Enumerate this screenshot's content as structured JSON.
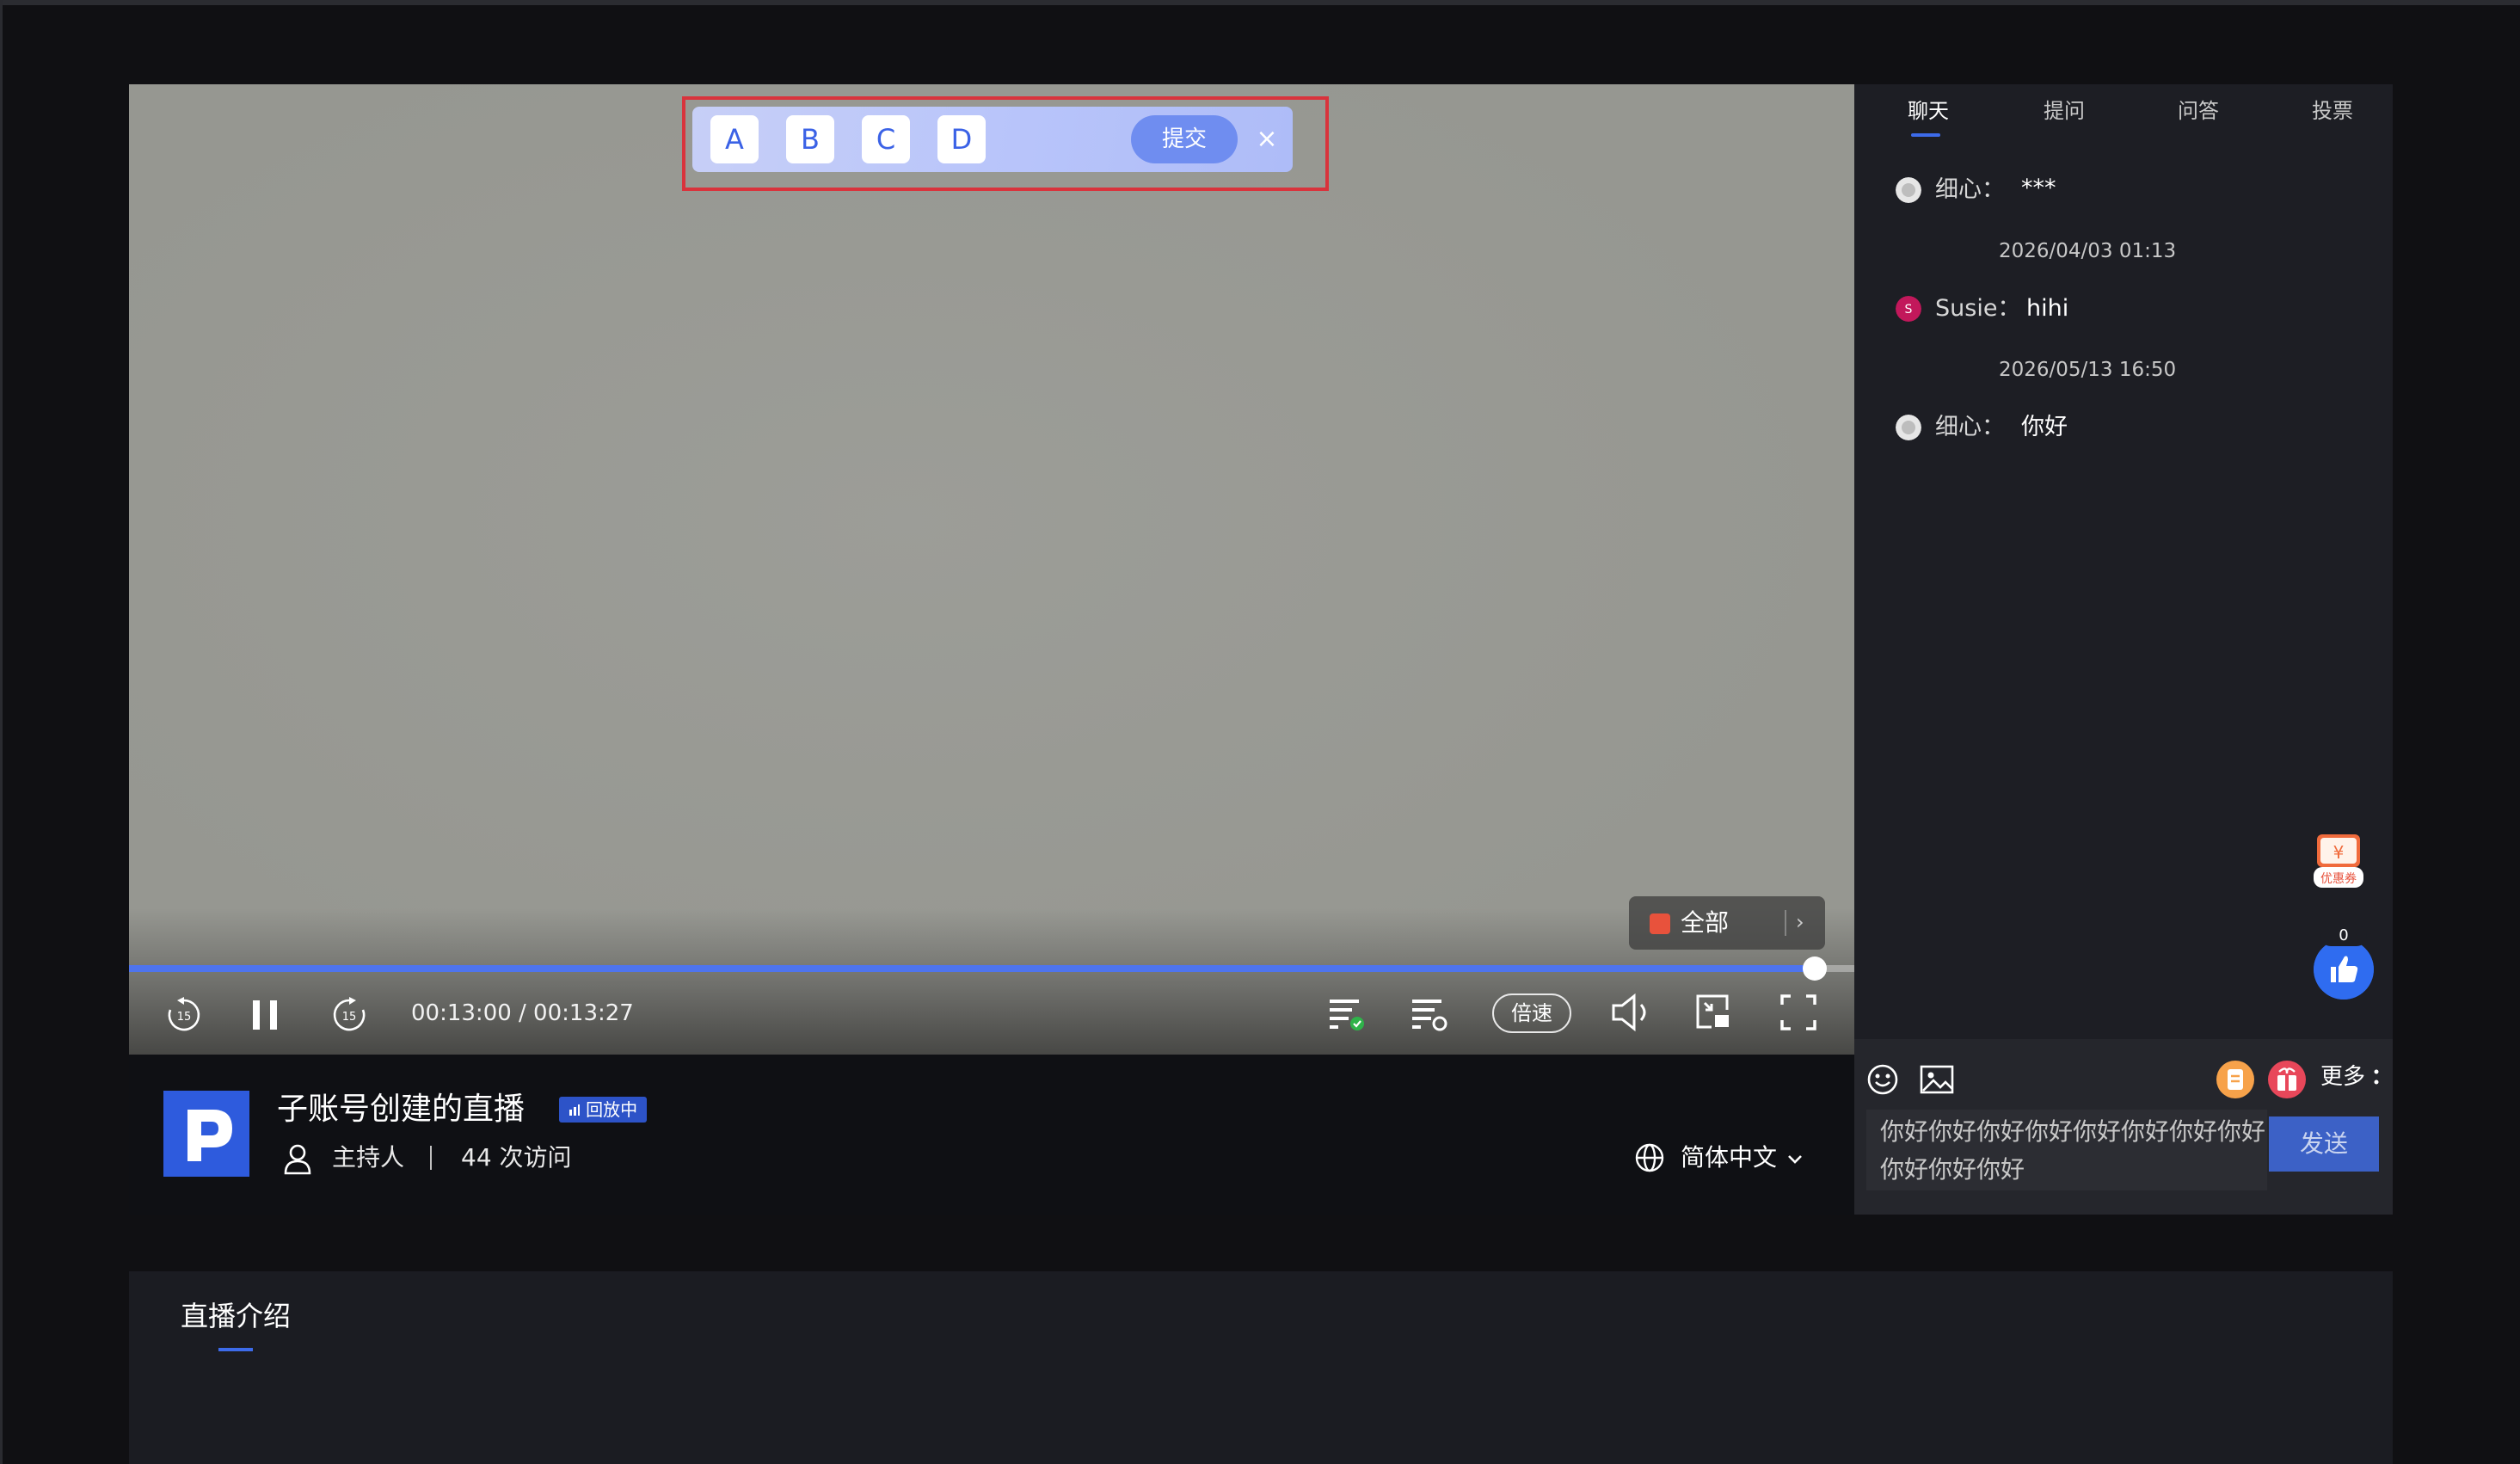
{
  "player": {
    "quiz": {
      "options": [
        "A",
        "B",
        "C",
        "D"
      ],
      "submit_label": "提交",
      "close_glyph": "×"
    },
    "time_display": "00:13:00 / 00:13:27",
    "progress": 0.977,
    "speed_label": "倍速",
    "filter_label": "全部",
    "filter_arrow": "›"
  },
  "info": {
    "title": "子账号创建的直播",
    "badge": "回放中",
    "host": "主持人",
    "visits": "44 次访问",
    "language": "简体中文"
  },
  "sidebar": {
    "tabs": [
      "聊天",
      "提问",
      "问答",
      "投票"
    ],
    "active_tab": "聊天",
    "messages": [
      {
        "name": "细心：",
        "text": "***",
        "time": "2026/04/03 01:13"
      },
      {
        "name": "Susie：",
        "text": "hihi",
        "time": "2026/05/13 16:50"
      },
      {
        "name": "细心：",
        "text": "你好"
      }
    ],
    "avatar_initial": "S",
    "coupon_label": "优惠券",
    "like_count": "0",
    "more_label": "更多",
    "input_value": "你好你好你好你好你好你好你好你好你好你好你好",
    "send_label": "发送"
  },
  "intro": {
    "title": "直播介绍"
  },
  "colors": {
    "accent": "#3d6bea",
    "quiz_border": "#d9333c",
    "send_button": "#3c61c6"
  }
}
